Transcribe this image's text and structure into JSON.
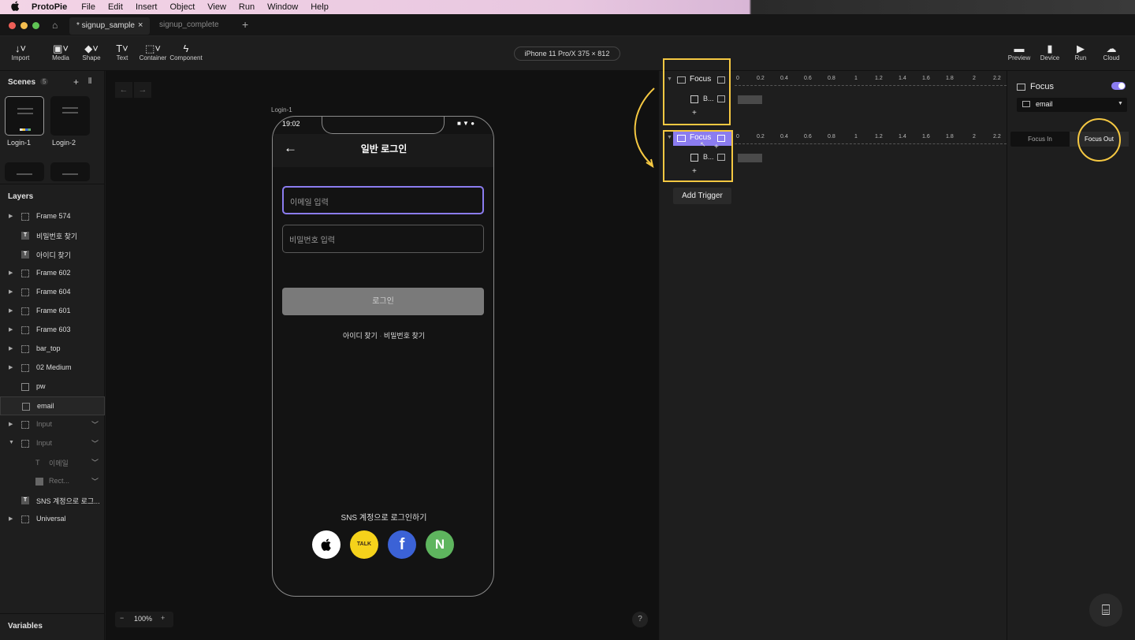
{
  "menubar": {
    "app_name": "ProtoPie",
    "items": [
      "File",
      "Edit",
      "Insert",
      "Object",
      "View",
      "Run",
      "Window",
      "Help"
    ]
  },
  "tabs": [
    {
      "label": "* signup_sample",
      "active": true
    },
    {
      "label": "signup_complete",
      "active": false
    }
  ],
  "toolbar": {
    "left_tools": [
      "Import",
      "Media",
      "Shape",
      "Text",
      "Container",
      "Component"
    ],
    "device": "iPhone 11 Pro/X  375 × 812",
    "right_tools": [
      "Preview",
      "Device",
      "Run",
      "Cloud"
    ]
  },
  "scenes": {
    "title": "Scenes",
    "count": "5",
    "items": [
      "Login-1",
      "Login-2"
    ]
  },
  "layers": {
    "title": "Layers",
    "items": [
      {
        "label": "Frame 574",
        "icon": "frame"
      },
      {
        "label": "비밀번호 찾기",
        "icon": "text"
      },
      {
        "label": "아이디 찾기",
        "icon": "text"
      },
      {
        "label": "Frame 602",
        "icon": "frame"
      },
      {
        "label": "Frame 604",
        "icon": "frame"
      },
      {
        "label": "Frame 601",
        "icon": "frame"
      },
      {
        "label": "Frame 603",
        "icon": "frame"
      },
      {
        "label": "bar_top",
        "icon": "frame"
      },
      {
        "label": "02 Medium",
        "icon": "frame"
      },
      {
        "label": "pw",
        "icon": "field"
      },
      {
        "label": "email",
        "icon": "field"
      },
      {
        "label": "Input",
        "icon": "frame"
      },
      {
        "label": "Input",
        "icon": "frame"
      },
      {
        "label": "이메일",
        "icon": "text-thin"
      },
      {
        "label": "Rect...",
        "icon": "rect"
      },
      {
        "label": "SNS 계정으로 로그...",
        "icon": "text"
      },
      {
        "label": "Universal",
        "icon": "frame"
      }
    ]
  },
  "variables_label": "Variables",
  "canvas": {
    "scene_label": "Login-1",
    "zoom": "100%",
    "help": "?"
  },
  "phone": {
    "time": "19:02",
    "title": "일반 로그인",
    "email_placeholder": "이메일 입력",
    "pw_placeholder": "비밀번호 입력",
    "login_button": "로그인",
    "find_id": "아이디 찾기",
    "find_pw": "비밀번호 찾기",
    "sns_title": "SNS 계정으로 로그인하기",
    "sns": [
      {
        "name": "apple",
        "glyph": ""
      },
      {
        "name": "kakao",
        "glyph": "TALK"
      },
      {
        "name": "facebook",
        "glyph": "f"
      },
      {
        "name": "naver",
        "glyph": "N"
      }
    ]
  },
  "interactions": {
    "triggers": [
      {
        "label": "Focus",
        "response": "B..."
      },
      {
        "label": "Focus",
        "response": "B..."
      }
    ],
    "ruler": [
      "0",
      "0.2",
      "0.4",
      "0.6",
      "0.8",
      "1",
      "1.2",
      "1.4",
      "1.6",
      "1.8",
      "2",
      "2.2"
    ],
    "add": "+",
    "add_trigger": "Add Trigger"
  },
  "properties": {
    "title": "Focus",
    "toggle_on": true,
    "target": "email",
    "options": [
      "Focus In",
      "Focus Out"
    ],
    "selected": "Focus Out"
  },
  "colors": {
    "accent": "#8b7cf0",
    "highlight": "#f5c842",
    "kakao": "#f5d21b",
    "facebook": "#3b62d6",
    "naver": "#5eb55e"
  }
}
